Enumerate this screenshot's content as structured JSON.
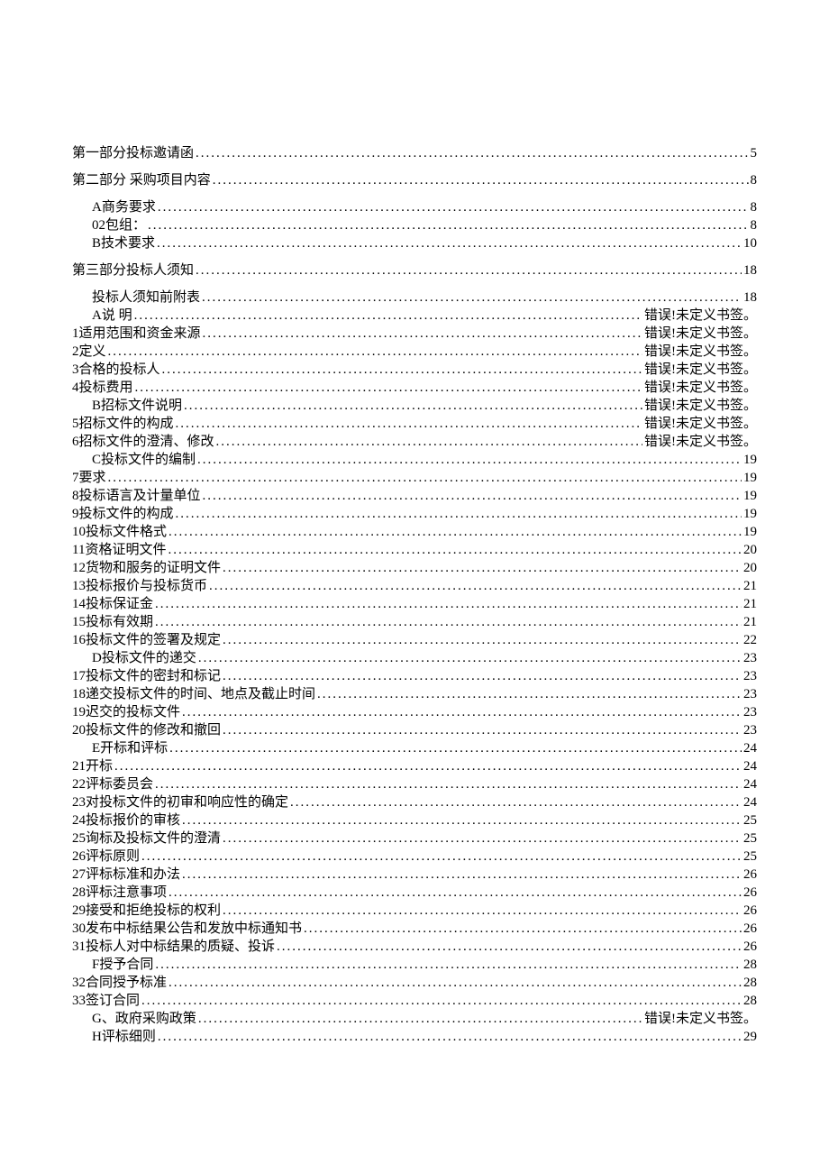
{
  "toc": [
    {
      "label": "第一部分投标邀请函",
      "page": "5",
      "level": 1
    },
    {
      "label": "第二部分  采购项目内容",
      "page": "8",
      "level": 1
    },
    {
      "label": "A商务要求",
      "page": "8",
      "level": 2
    },
    {
      "label": "02包组：",
      "page": "8",
      "level": 2
    },
    {
      "label": "B技术要求",
      "page": "10",
      "level": 2
    },
    {
      "label": "第三部分投标人须知",
      "page": "18",
      "level": 1
    },
    {
      "label": "投标人须知前附表",
      "page": "18",
      "level": 2
    },
    {
      "label": "A说  明",
      "page": "错误!未定义书签。",
      "level": 2
    },
    {
      "label": "1适用范围和资金来源",
      "page": "错误!未定义书签。",
      "level": 3
    },
    {
      "label": "2定义",
      "page": "错误!未定义书签。",
      "level": 3
    },
    {
      "label": "3合格的投标人",
      "page": "错误!未定义书签。",
      "level": 3
    },
    {
      "label": "4投标费用",
      "page": "错误!未定义书签。",
      "level": 3
    },
    {
      "label": "B招标文件说明",
      "page": "错误!未定义书签。",
      "level": 2
    },
    {
      "label": "5招标文件的构成",
      "page": "错误!未定义书签。",
      "level": 3
    },
    {
      "label": "6招标文件的澄清、修改",
      "page": "错误!未定义书签。",
      "level": 3
    },
    {
      "label": "C投标文件的编制",
      "page": "19",
      "level": 2
    },
    {
      "label": "7要求",
      "page": "19",
      "level": 3
    },
    {
      "label": "8投标语言及计量单位",
      "page": "19",
      "level": 3
    },
    {
      "label": "9投标文件的构成",
      "page": "19",
      "level": 3
    },
    {
      "label": "10投标文件格式",
      "page": "19",
      "level": 3
    },
    {
      "label": "11资格证明文件",
      "page": "20",
      "level": 3
    },
    {
      "label": "12货物和服务的证明文件",
      "page": "20",
      "level": 3
    },
    {
      "label": "13投标报价与投标货币",
      "page": "21",
      "level": 3
    },
    {
      "label": "14投标保证金",
      "page": "21",
      "level": 3
    },
    {
      "label": "15投标有效期",
      "page": "21",
      "level": 3
    },
    {
      "label": "16投标文件的签署及规定",
      "page": "22",
      "level": 3
    },
    {
      "label": "D投标文件的递交",
      "page": "23",
      "level": 2
    },
    {
      "label": "17投标文件的密封和标记",
      "page": "23",
      "level": 3
    },
    {
      "label": "18递交投标文件的时间、地点及截止时间",
      "page": "23",
      "level": 3
    },
    {
      "label": "19迟交的投标文件",
      "page": "23",
      "level": 3
    },
    {
      "label": "20投标文件的修改和撤回",
      "page": "23",
      "level": 3
    },
    {
      "label": "E开标和评标",
      "page": "24",
      "level": 2
    },
    {
      "label": "21开标",
      "page": "24",
      "level": 3
    },
    {
      "label": "22评标委员会",
      "page": "24",
      "level": 3
    },
    {
      "label": "23对投标文件的初审和响应性的确定",
      "page": "24",
      "level": 3
    },
    {
      "label": "24投标报价的审核",
      "page": "25",
      "level": 3
    },
    {
      "label": "25询标及投标文件的澄清",
      "page": "25",
      "level": 3
    },
    {
      "label": "26评标原则",
      "page": "25",
      "level": 3
    },
    {
      "label": "27评标标准和办法",
      "page": "26",
      "level": 3
    },
    {
      "label": "28评标注意事项",
      "page": "26",
      "level": 3
    },
    {
      "label": "29接受和拒绝投标的权利",
      "page": "26",
      "level": 3
    },
    {
      "label": "30发布中标结果公告和发放中标通知书",
      "page": "26",
      "level": 3
    },
    {
      "label": "31投标人对中标结果的质疑、投诉",
      "page": "26",
      "level": 3
    },
    {
      "label": "F授予合同",
      "page": "28",
      "level": 2
    },
    {
      "label": "32合同授予标准",
      "page": "28",
      "level": 3
    },
    {
      "label": "33签订合同",
      "page": "28",
      "level": 3
    },
    {
      "label": "G、政府采购政策",
      "page": "错误!未定义书签。",
      "level": 2
    },
    {
      "label": "H评标细则",
      "page": "29",
      "level": 2
    }
  ]
}
